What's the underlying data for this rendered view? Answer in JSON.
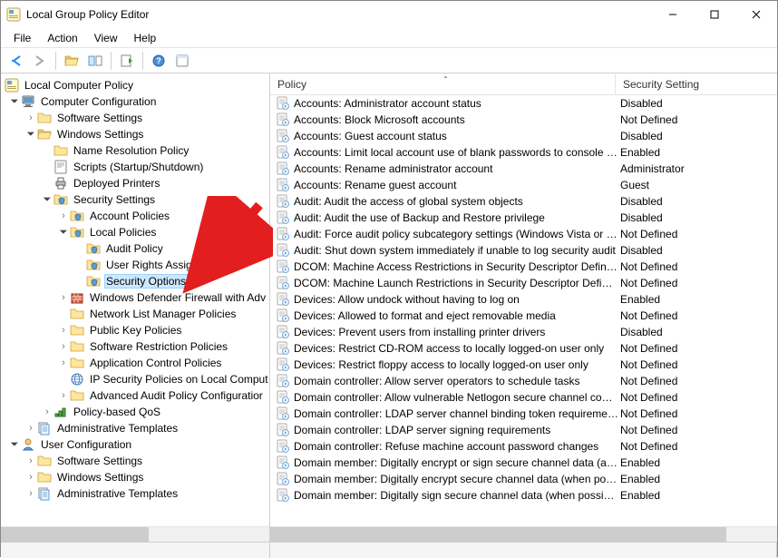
{
  "window": {
    "title": "Local Group Policy Editor"
  },
  "menu": {
    "file": "File",
    "action": "Action",
    "view": "View",
    "help": "Help"
  },
  "columns": {
    "policy": "Policy",
    "setting": "Security Setting"
  },
  "tree": {
    "root": "Local Computer Policy",
    "compConfig": "Computer Configuration",
    "softwareSettings": "Software Settings",
    "windowsSettings": "Windows Settings",
    "nameRes": "Name Resolution Policy",
    "scripts": "Scripts (Startup/Shutdown)",
    "deployedPrinters": "Deployed Printers",
    "securitySettings": "Security Settings",
    "accountPolicies": "Account Policies",
    "localPolicies": "Local Policies",
    "auditPolicy": "Audit Policy",
    "userRights": "User Rights Assignment",
    "securityOptions": "Security Options",
    "wdfirewall": "Windows Defender Firewall with Adv",
    "nlm": "Network List Manager Policies",
    "pubKey": "Public Key Policies",
    "softRestrict": "Software Restriction Policies",
    "appControl": "Application Control Policies",
    "ipSec": "IP Security Policies on Local Comput",
    "advAudit": "Advanced Audit Policy Configuratior",
    "policyQos": "Policy-based QoS",
    "adminTemplates": "Administrative Templates",
    "userConfig": "User Configuration",
    "u_software": "Software Settings",
    "u_windows": "Windows Settings",
    "u_admin": "Administrative Templates"
  },
  "policies": [
    {
      "name": "Accounts: Administrator account status",
      "setting": "Disabled"
    },
    {
      "name": "Accounts: Block Microsoft accounts",
      "setting": "Not Defined"
    },
    {
      "name": "Accounts: Guest account status",
      "setting": "Disabled"
    },
    {
      "name": "Accounts: Limit local account use of blank passwords to console logon only",
      "setting": "Enabled"
    },
    {
      "name": "Accounts: Rename administrator account",
      "setting": "Administrator"
    },
    {
      "name": "Accounts: Rename guest account",
      "setting": "Guest"
    },
    {
      "name": "Audit: Audit the access of global system objects",
      "setting": "Disabled"
    },
    {
      "name": "Audit: Audit the use of Backup and Restore privilege",
      "setting": "Disabled"
    },
    {
      "name": "Audit: Force audit policy subcategory settings (Windows Vista or later)",
      "setting": "Not Defined"
    },
    {
      "name": "Audit: Shut down system immediately if unable to log security audit",
      "setting": "Disabled"
    },
    {
      "name": "DCOM: Machine Access Restrictions in Security Descriptor Definition Language",
      "setting": "Not Defined"
    },
    {
      "name": "DCOM: Machine Launch Restrictions in Security Descriptor Definition Language",
      "setting": "Not Defined"
    },
    {
      "name": "Devices: Allow undock without having to log on",
      "setting": "Enabled"
    },
    {
      "name": "Devices: Allowed to format and eject removable media",
      "setting": "Not Defined"
    },
    {
      "name": "Devices: Prevent users from installing printer drivers",
      "setting": "Disabled"
    },
    {
      "name": "Devices: Restrict CD-ROM access to locally logged-on user only",
      "setting": "Not Defined"
    },
    {
      "name": "Devices: Restrict floppy access to locally logged-on user only",
      "setting": "Not Defined"
    },
    {
      "name": "Domain controller: Allow server operators to schedule tasks",
      "setting": "Not Defined"
    },
    {
      "name": "Domain controller: Allow vulnerable Netlogon secure channel connections",
      "setting": "Not Defined"
    },
    {
      "name": "Domain controller: LDAP server channel binding token requirements",
      "setting": "Not Defined"
    },
    {
      "name": "Domain controller: LDAP server signing requirements",
      "setting": "Not Defined"
    },
    {
      "name": "Domain controller: Refuse machine account password changes",
      "setting": "Not Defined"
    },
    {
      "name": "Domain member: Digitally encrypt or sign secure channel data (always)",
      "setting": "Enabled"
    },
    {
      "name": "Domain member: Digitally encrypt secure channel data (when possible)",
      "setting": "Enabled"
    },
    {
      "name": "Domain member: Digitally sign secure channel data (when possible)",
      "setting": "Enabled"
    }
  ]
}
